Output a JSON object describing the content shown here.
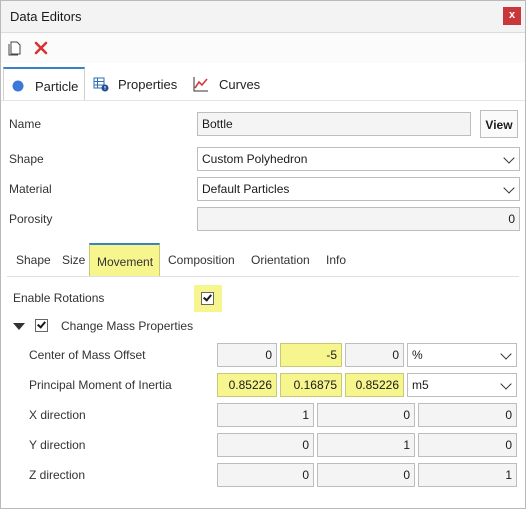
{
  "window": {
    "title": "Data Editors",
    "close_label": "x"
  },
  "toolbar": {
    "new_icon": "document-icon",
    "delete_icon": "red-x-icon"
  },
  "main_tabs": [
    {
      "label": "Particle",
      "icon": "circle-icon",
      "active": true
    },
    {
      "label": "Properties",
      "icon": "properties-grid-icon",
      "active": false
    },
    {
      "label": "Curves",
      "icon": "line-chart-icon",
      "active": false
    }
  ],
  "particle": {
    "name_label": "Name",
    "name_value": "Bottle",
    "view_button": "View",
    "shape_label": "Shape",
    "shape_value": "Custom Polyhedron",
    "material_label": "Material",
    "material_value": "Default Particles",
    "porosity_label": "Porosity",
    "porosity_value": "0"
  },
  "sub_tabs": [
    {
      "label": "Shape",
      "active": false
    },
    {
      "label": "Size",
      "active": false
    },
    {
      "label": "Movement",
      "active": true
    },
    {
      "label": "Composition",
      "active": false
    },
    {
      "label": "Orientation",
      "active": false
    },
    {
      "label": "Info",
      "active": false
    }
  ],
  "movement": {
    "enable_rotations_label": "Enable Rotations",
    "enable_rotations_checked": true,
    "change_mass_label": "Change Mass Properties",
    "change_mass_checked": true,
    "com_label": "Center of Mass Offset",
    "com_values": [
      "0",
      "-5",
      "0"
    ],
    "com_unit": "%",
    "pmi_label": "Principal Moment of Inertia",
    "pmi_values": [
      "0.85226",
      "0.16875",
      "0.85226"
    ],
    "pmi_unit": "m5",
    "xdir_label": "X direction",
    "xdir_values": [
      "1",
      "0",
      "0"
    ],
    "ydir_label": "Y direction",
    "ydir_values": [
      "0",
      "1",
      "0"
    ],
    "zdir_label": "Z direction",
    "zdir_values": [
      "0",
      "0",
      "1"
    ]
  },
  "colors": {
    "highlight": "#f7f58d",
    "accent": "#3b82c4",
    "close": "#c8373a"
  }
}
